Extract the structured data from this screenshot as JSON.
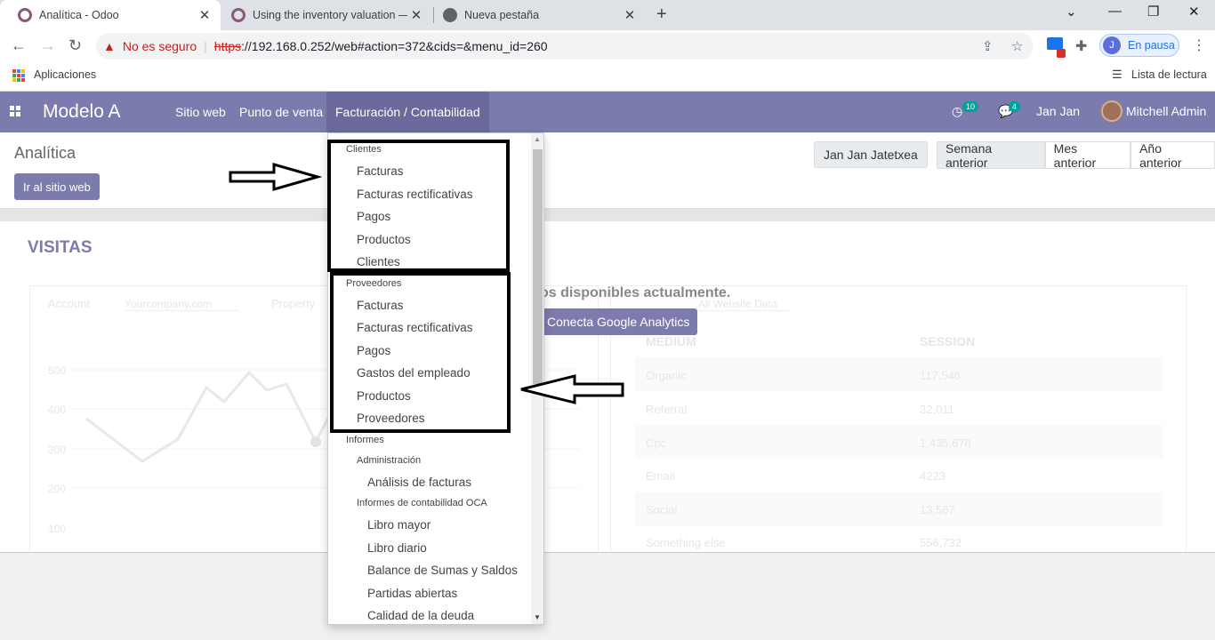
{
  "browser": {
    "tabs": [
      {
        "title": "Analítica - Odoo",
        "icon": "odoo-icon"
      },
      {
        "title": "Using the inventory valuation —",
        "icon": "odoo-icon"
      },
      {
        "title": "Nueva pestaña",
        "icon": "globe-icon"
      }
    ],
    "new_tab": "+",
    "security_label": "No es seguro",
    "url_scheme": "https",
    "url_rest": "://192.168.0.252/web#action=372&cids=&menu_id=260",
    "profile_initial": "J",
    "profile_status": "En pausa",
    "bookmarks": {
      "apps": "Aplicaciones",
      "reading_list": "Lista de lectura"
    }
  },
  "odoo": {
    "brand": "Modelo A",
    "menus": [
      "Sitio web",
      "Punto de venta",
      "Facturación / Contabilidad"
    ],
    "activity_count": "10",
    "message_count": "4",
    "company": "Jan Jan",
    "user": "Mitchell Admin"
  },
  "control_panel": {
    "breadcrumb": "Analítica",
    "go_site_button": "Ir al sitio web",
    "user_button": "Jan Jan Jatetxea",
    "periods": [
      "Semana anterior",
      "Mes anterior",
      "Año anterior"
    ]
  },
  "dashboard": {
    "title": "VISITAS",
    "nodata_text": "os disponibles actualmente.",
    "ga_button": "Conecta Google Analytics",
    "ghost": {
      "account": "Account",
      "company": "Yourcompany.com",
      "property": "Property",
      "all_data": "All Website Data",
      "y_ticks": [
        "500",
        "400",
        "300",
        "200",
        "100"
      ],
      "medium": "MEDIUM",
      "session": "SESSION",
      "rows": [
        [
          "Organic",
          "117,546"
        ],
        [
          "Referral",
          "32,011"
        ],
        [
          "Cpc",
          "1,435,678"
        ],
        [
          "Email",
          "4223"
        ],
        [
          "Social",
          "13,567"
        ],
        [
          "Something else",
          "556,732"
        ]
      ]
    }
  },
  "dropdown": {
    "clientes_header": "Clientes",
    "clientes": [
      "Facturas",
      "Facturas rectificativas",
      "Pagos",
      "Productos",
      "Clientes"
    ],
    "proveedores_header": "Proveedores",
    "proveedores": [
      "Facturas",
      "Facturas rectificativas",
      "Pagos",
      "Gastos del empleado",
      "Productos",
      "Proveedores"
    ],
    "informes_header": "Informes",
    "administracion": "Administración",
    "admin_items": [
      "Análisis de facturas"
    ],
    "oca": "Informes de contabilidad OCA",
    "oca_items": [
      "Libro mayor",
      "Libro diario",
      "Balance de Sumas y Saldos",
      "Partidas abiertas",
      "Calidad de la deuda"
    ]
  }
}
